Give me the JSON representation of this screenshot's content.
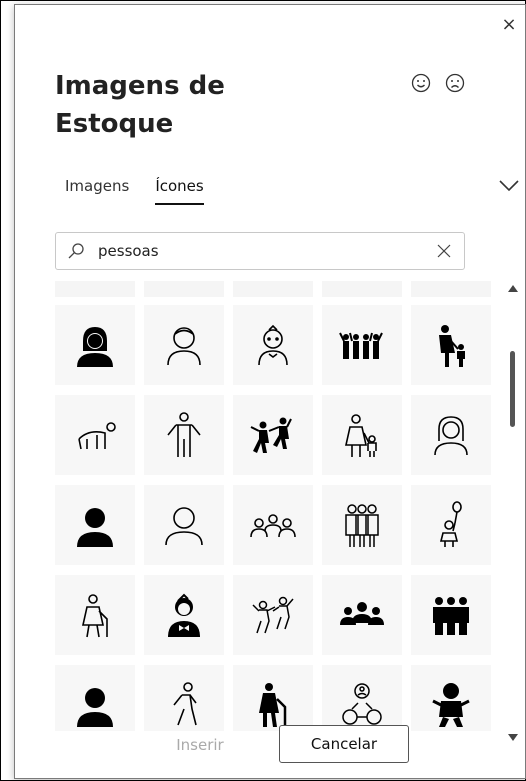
{
  "dialog": {
    "title": "Imagens de Estoque",
    "close_label": "×"
  },
  "tabs": [
    {
      "label": "Imagens",
      "active": false
    },
    {
      "label": "Ícones",
      "active": true
    }
  ],
  "search": {
    "value": "pessoas",
    "placeholder": ""
  },
  "icons": [
    "woman-silhouette-icon",
    "man-outline-icon",
    "boy-outline-icon",
    "group-cheering-icon",
    "adult-child-icon",
    "person-crawling-icon",
    "person-arms-out-icon",
    "people-dancing-icon",
    "mother-child-icon",
    "woman-outline-icon",
    "person-filled-icon",
    "person-outline-icon",
    "three-people-outline-icon",
    "family-outline-icon",
    "girl-balloon-icon",
    "elderly-woman-cane-icon",
    "boy-bowtie-icon",
    "people-jumping-icon",
    "group-filled-icon",
    "three-people-filled-icon",
    "person-filled-2-icon",
    "person-walking-icon",
    "elderly-person-cane-icon",
    "people-network-icon",
    "baby-icon"
  ],
  "footer": {
    "insert_label": "Inserir",
    "cancel_label": "Cancelar"
  },
  "colors": {
    "icon": "#000000",
    "tile": "#f7f7f7",
    "disabled_text": "#aaaaaa"
  }
}
